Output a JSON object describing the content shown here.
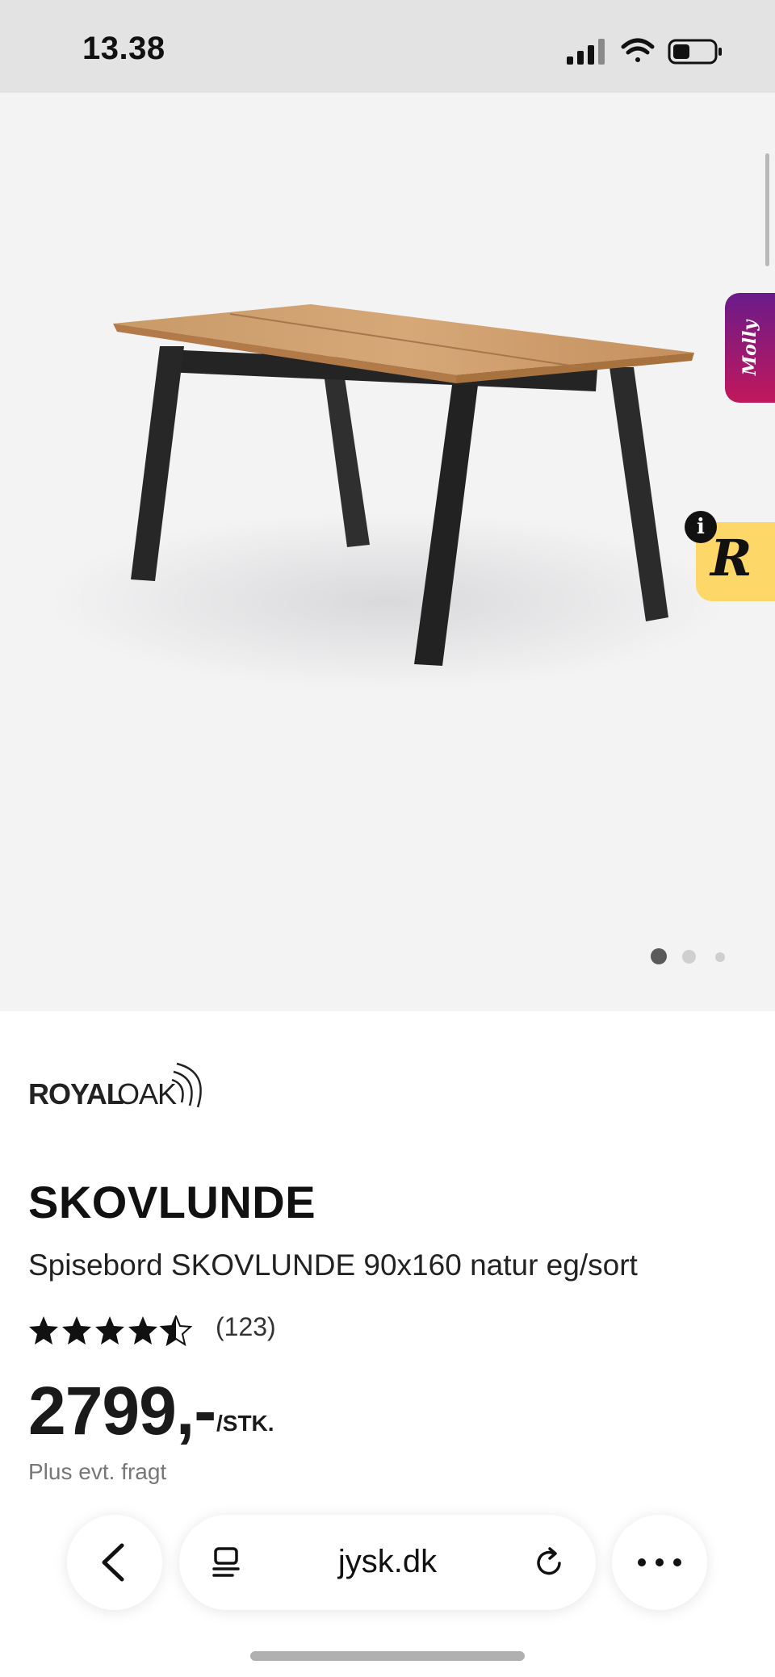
{
  "status_bar": {
    "time": "13.38",
    "icons": [
      "cellular-signal-icon",
      "wifi-icon",
      "battery-icon"
    ]
  },
  "gallery": {
    "image": "dining-table-image",
    "badges": {
      "molly_label": "Molly",
      "r_label": "R",
      "info_label": "i"
    },
    "pagination": {
      "total": 3,
      "active": 1
    }
  },
  "product": {
    "brand": "ROYALOAK",
    "title": "SKOVLUNDE",
    "subtitle": "Spisebord SKOVLUNDE 90x160 natur eg/sort",
    "rating": {
      "stars": 4.5,
      "max": 5,
      "count": "(123)"
    },
    "price": "2799,-",
    "price_unit": "/STK.",
    "shipping_note": "Plus evt. fragt"
  },
  "browser": {
    "url": "jysk.dk",
    "buttons": [
      "back-icon",
      "tabs-icon",
      "reload-icon",
      "more-icon"
    ]
  },
  "colors": {
    "gallery_bg": "#f3f3f4",
    "tabletop": "#c99a68",
    "legs": "#2b2b2b",
    "molly_gradient_top": "#6a1b8a",
    "molly_gradient_bottom": "#c2185b",
    "r_badge": "#fdd868"
  }
}
